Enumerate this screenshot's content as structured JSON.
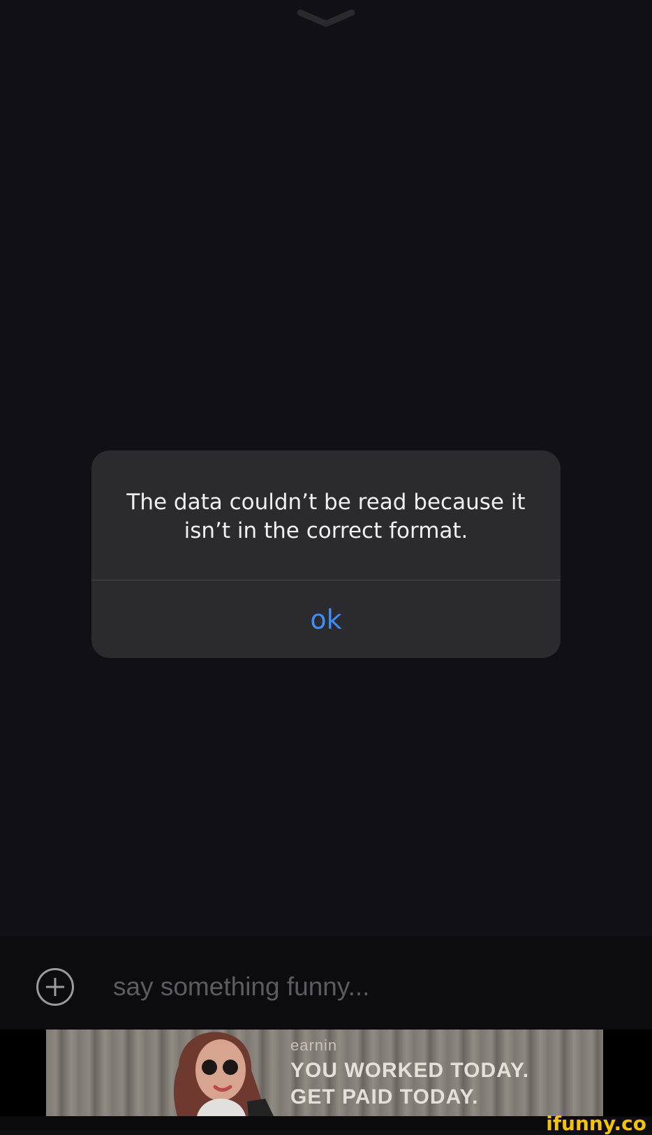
{
  "alert": {
    "message": "The data couldn’t be read because it isn’t in the correct format.",
    "ok_label": "ok"
  },
  "compose": {
    "placeholder": "say something funny..."
  },
  "ad": {
    "brand": "earnin",
    "line1": "YOU WORKED TODAY.",
    "line2": "GET PAID TODAY."
  },
  "watermark": "ifunny.co",
  "colors": {
    "background": "#0f0e13",
    "alert_background": "#2b2a2f",
    "button_blue": "#3e8ef7"
  },
  "icons": [
    "chevron-down-icon",
    "plus-circle-icon"
  ]
}
